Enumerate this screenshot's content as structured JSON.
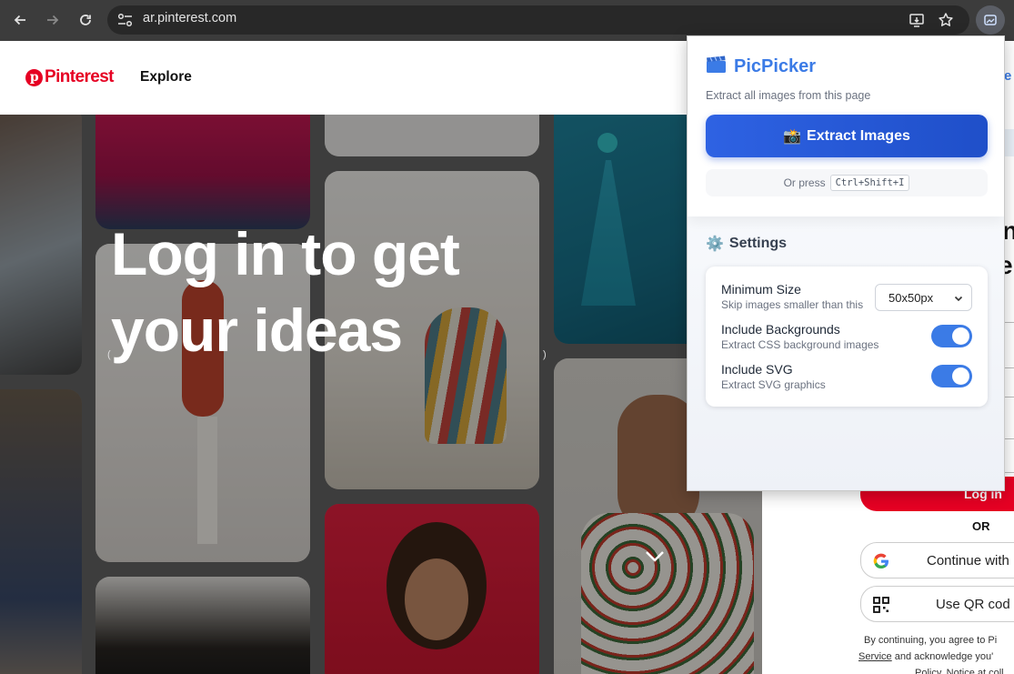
{
  "browser": {
    "url": "ar.pinterest.com",
    "icons": [
      "back-arrow-icon",
      "forward-arrow-icon",
      "reload-icon",
      "site-info-icon",
      "install-app-icon",
      "bookmark-star-icon",
      "extension-icon"
    ]
  },
  "pinterest": {
    "logo_text": "Pinterest",
    "explore_label": "Explore",
    "hero_line1": "Log in to get",
    "hero_line2": "your ideas",
    "paren_left": "(",
    "paren_right": ")",
    "partial_text_1": "e",
    "partial_text_2": "n",
    "partial_text_3": "e",
    "login_label": "Log in",
    "or_label": "OR",
    "google_label": "Continue with",
    "qr_label": "Use QR cod",
    "terms_line1": "By continuing, you agree to Pi",
    "terms_service": "Service",
    "terms_line2": " and acknowledge you'",
    "terms_line3": "Policy. Notice at coll",
    "brand_color": "#e60023"
  },
  "popup": {
    "title": "PicPicker",
    "subtitle": "Extract all images from this page",
    "extract_label": "Extract Images",
    "extract_emoji": "📸",
    "shortcut_prefix": "Or press",
    "shortcut_keys": "Ctrl+Shift+I",
    "settings_title": "Settings",
    "settings_emoji": "⚙️",
    "min_size_label": "Minimum Size",
    "min_size_help": "Skip images smaller than this",
    "min_size_value": "50x50px",
    "bg_label": "Include Backgrounds",
    "bg_help": "Extract CSS background images",
    "bg_enabled": true,
    "svg_label": "Include SVG",
    "svg_help": "Extract SVG graphics",
    "svg_enabled": true,
    "accent_color": "#3b7be6",
    "button_color": "#2554d2"
  }
}
